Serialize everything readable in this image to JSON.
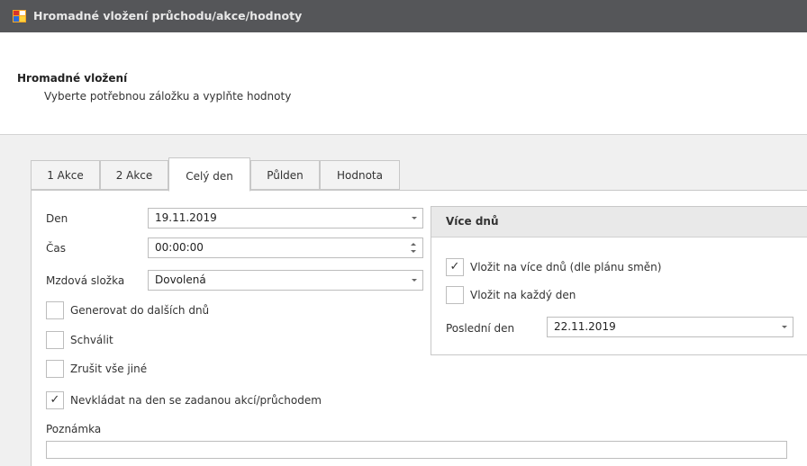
{
  "window": {
    "title": "Hromadné vložení průchodu/akce/hodnoty"
  },
  "header": {
    "title": "Hromadné vložení",
    "subtitle": "Vyberte potřebnou záložku a vyplňte hodnoty"
  },
  "tabs": [
    {
      "label": "1 Akce",
      "active": false
    },
    {
      "label": "2 Akce",
      "active": false
    },
    {
      "label": "Celý den",
      "active": true
    },
    {
      "label": "Půlden",
      "active": false
    },
    {
      "label": "Hodnota",
      "active": false
    }
  ],
  "form": {
    "den_label": "Den",
    "den_value": "19.11.2019",
    "cas_label": "Čas",
    "cas_value": "00:00:00",
    "mzdova_label": "Mzdová složka",
    "mzdova_value": "Dovolená",
    "generovat_label": "Generovat do dalších dnů",
    "generovat_checked": false,
    "schvalit_label": "Schválit",
    "schvalit_checked": false,
    "zrusit_label": "Zrušit vše jiné",
    "zrusit_checked": false,
    "nevkladat_label": "Nevkládat na den se zadanou akcí/průchodem",
    "nevkladat_checked": true,
    "poznamka_label": "Poznámka",
    "poznamka_value": ""
  },
  "vice_dnu": {
    "title": "Více dnů",
    "vlozit_vice_label": "Vložit na více dnů (dle plánu směn)",
    "vlozit_vice_checked": true,
    "vlozit_kazdy_label": "Vložit na každý den",
    "vlozit_kazdy_checked": false,
    "posledni_label": "Poslední den",
    "posledni_value": "22.11.2019"
  },
  "check_glyph": "✓",
  "colors": {
    "titlebar": "#555659",
    "group_header": "#e9e9e9"
  }
}
